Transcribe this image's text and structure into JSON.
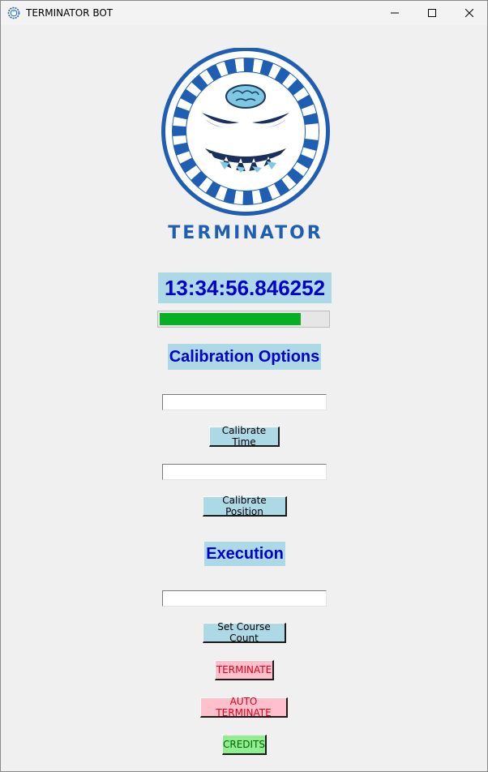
{
  "window": {
    "title": "TERMINATOR BOT",
    "controls": [
      "minimize",
      "maximize",
      "close"
    ]
  },
  "logo": {
    "wordmark": "TERMINATOR",
    "icon": "grinning-face-with-brain-in-gear-icon"
  },
  "clock": {
    "time": "13:34:56.846252"
  },
  "progress": {
    "fraction": 0.84,
    "color": "#06b025"
  },
  "calibration": {
    "heading": "Calibration Options",
    "time_input_value": "",
    "time_button": "Calibrate Time",
    "position_input_value": "",
    "position_button": "Calibrate Position"
  },
  "execution": {
    "heading": "Execution",
    "course_input_value": "",
    "course_button": "Set Course Count",
    "terminate_button": "TERMINATE",
    "auto_terminate_button": "AUTO TERMINATE",
    "credits_button": "CREDITS"
  },
  "colors": {
    "heading_bg": "#add8e6",
    "heading_text": "#0000cd",
    "terminate_bg": "#ffc0cb",
    "credits_bg": "#90ee90",
    "logo_blue": "#1e5fb3"
  }
}
